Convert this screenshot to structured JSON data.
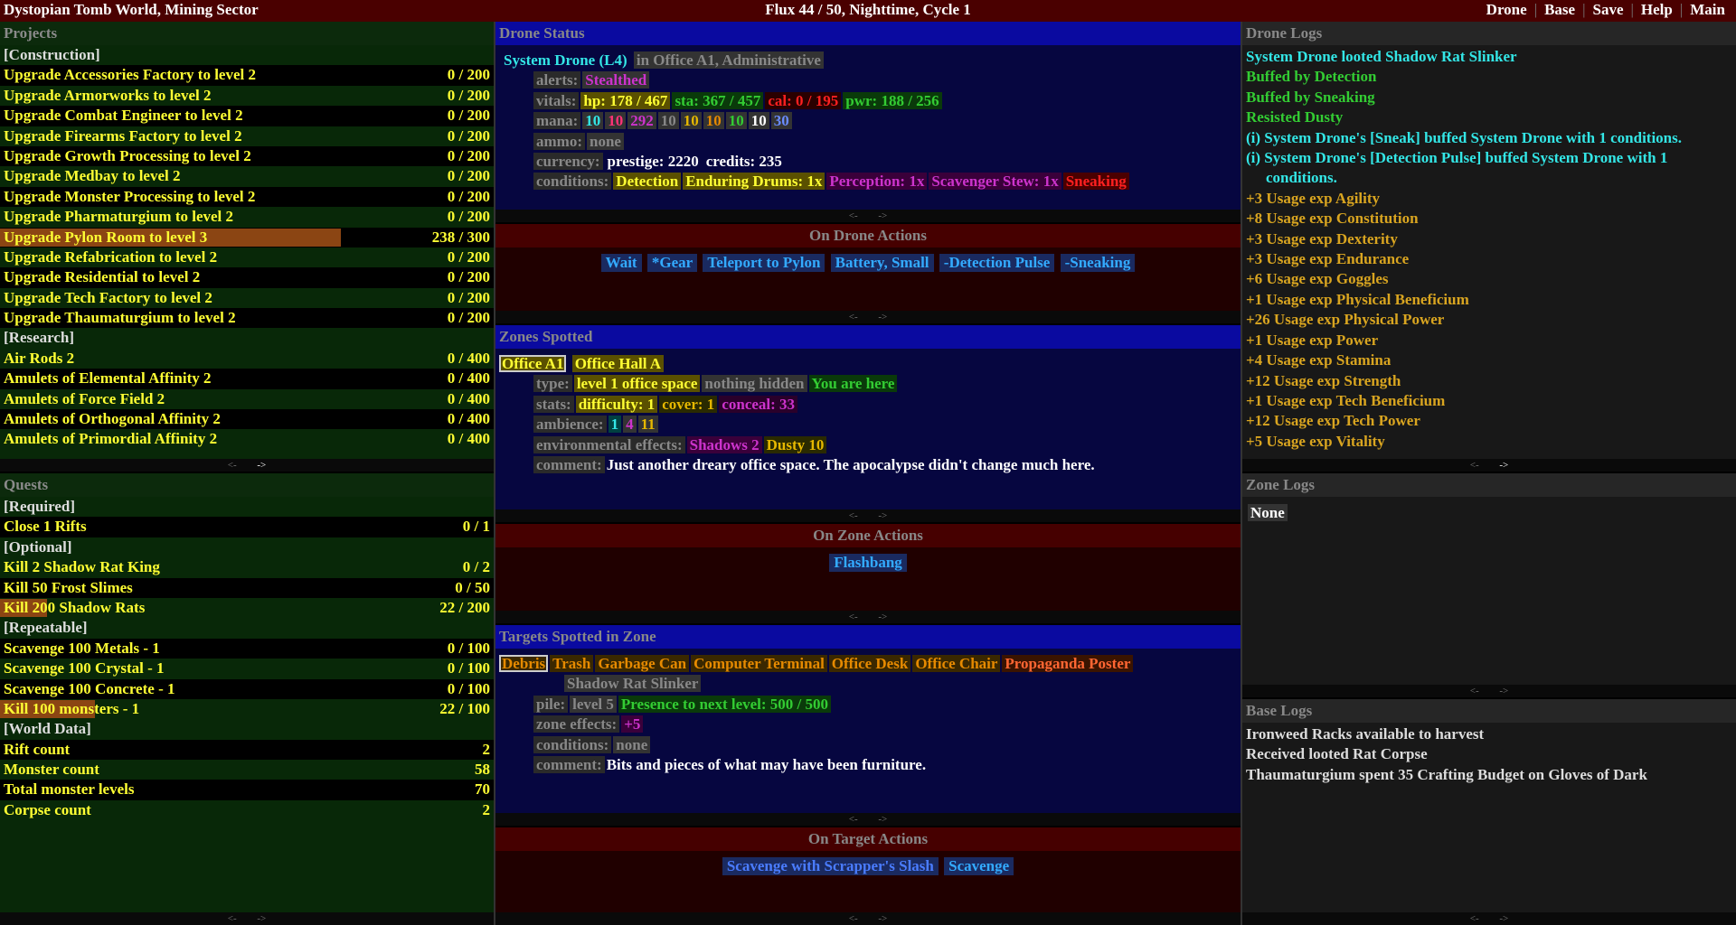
{
  "topbar": {
    "title": "Dystopian Tomb World, Mining Sector",
    "status": "Flux 44 / 50, Nighttime, Cycle 1",
    "nav": [
      "Drone",
      "Base",
      "Save",
      "Help",
      "Main"
    ]
  },
  "pager": {
    "prev": "<-",
    "next": "->"
  },
  "projects": {
    "title": "Projects",
    "construction_label": "[Construction]",
    "construction": [
      {
        "name": "Upgrade Accessories Factory to level 2",
        "val": "0 / 200"
      },
      {
        "name": "Upgrade Armorworks to level 2",
        "val": "0 / 200"
      },
      {
        "name": "Upgrade Combat Engineer to level 2",
        "val": "0 / 200"
      },
      {
        "name": "Upgrade Firearms Factory to level 2",
        "val": "0 / 200"
      },
      {
        "name": "Upgrade Growth Processing to level 2",
        "val": "0 / 200"
      },
      {
        "name": "Upgrade Medbay to level 2",
        "val": "0 / 200"
      },
      {
        "name": "Upgrade Monster Processing to level 2",
        "val": "0 / 200"
      },
      {
        "name": "Upgrade Pharmaturgium to level 2",
        "val": "0 / 200"
      },
      {
        "name": "Upgrade Pylon Room to level 3",
        "val": "238 / 300",
        "progress": 0.793
      },
      {
        "name": "Upgrade Refabrication to level 2",
        "val": "0 / 200"
      },
      {
        "name": "Upgrade Residential to level 2",
        "val": "0 / 200"
      },
      {
        "name": "Upgrade Tech Factory to level 2",
        "val": "0 / 200"
      },
      {
        "name": "Upgrade Thaumaturgium to level 2",
        "val": "0 / 200"
      }
    ],
    "research_label": "[Research]",
    "research": [
      {
        "name": "Air Rods 2",
        "val": "0 / 400"
      },
      {
        "name": "Amulets of Elemental Affinity 2",
        "val": "0 / 400"
      },
      {
        "name": "Amulets of Force Field 2",
        "val": "0 / 400"
      },
      {
        "name": "Amulets of Orthogonal Affinity 2",
        "val": "0 / 400"
      },
      {
        "name": "Amulets of Primordial Affinity 2",
        "val": "0 / 400"
      }
    ]
  },
  "quests": {
    "title": "Quests",
    "required_label": "[Required]",
    "required": [
      {
        "name": "Close 1 Rifts",
        "val": "0 / 1"
      }
    ],
    "optional_label": "[Optional]",
    "optional": [
      {
        "name": "Kill 2 Shadow Rat King",
        "val": "0 / 2"
      },
      {
        "name": "Kill 50 Frost Slimes",
        "val": "0 / 50"
      },
      {
        "name": "Kill 200 Shadow Rats",
        "val": "22 / 200",
        "progress": 0.11
      }
    ],
    "repeatable_label": "[Repeatable]",
    "repeatable": [
      {
        "name": "Scavenge 100 Metals - 1",
        "val": "0 / 100"
      },
      {
        "name": "Scavenge 100 Crystal - 1",
        "val": "0 / 100"
      },
      {
        "name": "Scavenge 100 Concrete - 1",
        "val": "0 / 100"
      },
      {
        "name": "Kill 100 monsters - 1",
        "val": "22 / 100",
        "progress": 0.22
      }
    ],
    "world_label": "[World Data]",
    "world": [
      {
        "name": "Rift count",
        "val": "2"
      },
      {
        "name": "Monster count",
        "val": "58"
      },
      {
        "name": "Total monster levels",
        "val": "70"
      },
      {
        "name": "Corpse count",
        "val": "2"
      }
    ]
  },
  "drone_status": {
    "title": "Drone Status",
    "name": "System Drone (L4)",
    "location": "in Office A1, Administrative",
    "alerts_label": "alerts:",
    "alerts": "Stealthed",
    "vitals_label": "vitals:",
    "hp": "hp: 178 / 467",
    "sta": "sta: 367 / 457",
    "cal": "cal: 0 / 195",
    "pwr": "pwr: 188 / 256",
    "mana_label": "mana:",
    "mana": [
      "10",
      "10",
      "292",
      "10",
      "10",
      "10",
      "10",
      "10",
      "30"
    ],
    "ammo_label": "ammo:",
    "ammo": "none",
    "currency_label": "currency:",
    "prestige": "prestige: 2220",
    "credits": "credits: 235",
    "conditions_label": "conditions:",
    "conditions": [
      "Detection",
      "Enduring Drums: 1x",
      "Perception: 1x",
      "Scavenger Stew: 1x",
      "Sneaking"
    ]
  },
  "drone_actions": {
    "title": "On Drone Actions",
    "items": [
      "Wait",
      "*Gear",
      "Teleport to Pylon",
      "Battery, Small",
      "-Detection Pulse",
      "-Sneaking"
    ]
  },
  "zones": {
    "title": "Zones Spotted",
    "tabs": [
      "Office A1",
      "Office Hall A"
    ],
    "type_label": "type:",
    "type": "level 1 office space",
    "hidden": "nothing hidden",
    "here": "You are here",
    "stats_label": "stats:",
    "difficulty": "difficulty: 1",
    "cover": "cover: 1",
    "conceal": "conceal: 33",
    "ambience_label": "ambience:",
    "ambience": [
      "1",
      "4",
      "11"
    ],
    "env_label": "environmental effects:",
    "env": [
      "Shadows 2",
      "Dusty 10"
    ],
    "comment_label": "comment:",
    "comment": "Just another dreary office space. The apocalypse didn't change much here."
  },
  "zone_actions": {
    "title": "On Zone Actions",
    "items": [
      "Flashbang"
    ]
  },
  "targets": {
    "title": "Targets Spotted in Zone",
    "tabs": [
      "Debris",
      "Trash",
      "Garbage Can",
      "Computer Terminal",
      "Office Desk",
      "Office Chair",
      "Propaganda Poster"
    ],
    "sub": "Shadow Rat Slinker",
    "pile_label": "pile:",
    "level": "level 5",
    "presence": "Presence to next level: 500 / 500",
    "zone_effects_label": "zone effects:",
    "zone_effects": "+5",
    "conditions_label": "conditions:",
    "conditions": "none",
    "comment_label": "comment:",
    "comment": "Bits and pieces of what may have been furniture."
  },
  "target_actions": {
    "title": "On Target Actions",
    "items": [
      "Scavenge with Scrapper's Slash",
      "Scavenge"
    ]
  },
  "drone_logs": {
    "title": "Drone Logs",
    "lines": [
      {
        "t": "System Drone looted Shadow Rat Slinker",
        "c": "cyan"
      },
      {
        "t": "Buffed by Detection",
        "c": "green"
      },
      {
        "t": "Buffed by Sneaking",
        "c": "green"
      },
      {
        "t": "Resisted Dusty",
        "c": "green"
      },
      {
        "t": "(i) System Drone's [Sneak] buffed System Drone with 1 conditions.",
        "c": "cyan",
        "wrap": true
      },
      {
        "t": "(i) System Drone's [Detection Pulse] buffed System Drone with 1 conditions.",
        "c": "cyan",
        "wrap": true
      },
      {
        "t": "+3 Usage exp Agility",
        "c": "gold"
      },
      {
        "t": "+8 Usage exp Constitution",
        "c": "gold"
      },
      {
        "t": "+3 Usage exp Dexterity",
        "c": "gold"
      },
      {
        "t": "+3 Usage exp Endurance",
        "c": "gold"
      },
      {
        "t": "+6 Usage exp Goggles",
        "c": "gold"
      },
      {
        "t": "+1 Usage exp Physical Beneficium",
        "c": "gold"
      },
      {
        "t": "+26 Usage exp Physical Power",
        "c": "gold"
      },
      {
        "t": "+1 Usage exp Power",
        "c": "gold"
      },
      {
        "t": "+4 Usage exp Stamina",
        "c": "gold"
      },
      {
        "t": "+12 Usage exp Strength",
        "c": "gold"
      },
      {
        "t": "+1 Usage exp Tech Beneficium",
        "c": "gold"
      },
      {
        "t": "+12 Usage exp Tech Power",
        "c": "gold"
      },
      {
        "t": "+5 Usage exp Vitality",
        "c": "gold"
      }
    ]
  },
  "zone_logs": {
    "title": "Zone Logs",
    "none": "None"
  },
  "base_logs": {
    "title": "Base Logs",
    "lines": [
      "Ironweed Racks available to harvest",
      "Received looted Rat Corpse",
      "Thaumaturgium spent 35 Crafting Budget on Gloves of Dark"
    ]
  }
}
